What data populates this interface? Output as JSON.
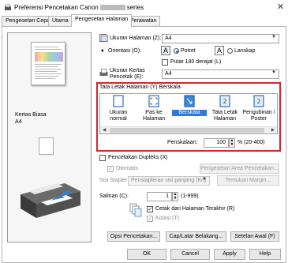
{
  "window": {
    "title_prefix": "Preferensi Pencetakan Canon",
    "title_suffix": "series",
    "close_glyph": "✕"
  },
  "tabs": [
    {
      "label": "Pengesetan Cepat"
    },
    {
      "label": "Utama"
    },
    {
      "label": "Pengesetan Halaman"
    },
    {
      "label": "Perawatan"
    }
  ],
  "preview": {
    "media_label": "Kertas Biasa",
    "size_label": "A4"
  },
  "page_size": {
    "label": "Ukuran Halaman (Z):",
    "value": "A4"
  },
  "orientation": {
    "label": "Orientasi (O):",
    "portrait": "Potret",
    "landscape": "Lanskap",
    "selected": "Potret",
    "rotate_label": "Putar 180 derajat (L)",
    "rotate_checked": false
  },
  "paper_size": {
    "label_line1": "Ukuran Kertas",
    "label_line2": "Pencetak (E):",
    "value": "A4"
  },
  "layout": {
    "group_label": "Tata Letak Halaman (Y) Berskala",
    "items": [
      {
        "label": "Ukuran normal"
      },
      {
        "label": "Pas ke Halaman"
      },
      {
        "label": "Berskala"
      },
      {
        "label": "Tata Letak Halaman"
      },
      {
        "label": "Pengubinan / Poster"
      }
    ],
    "selected": "Berskala",
    "tile_icon_numbers": [
      "2",
      "2"
    ],
    "scaling_label": "Penskalaan:",
    "scaling_value": "100",
    "scaling_range": "% (20-400)"
  },
  "duplex": {
    "label": "Pencetakan Dupleks (X)",
    "checked": false,
    "auto_label": "Otomatis",
    "area_button": "Pengesetan Area Pencetakan...",
    "stapling_label": "Sisi Stapler (L):",
    "stapling_value": "Penstapleran sisi panjang (Kri)",
    "margin_button": "Tentukan Margin..."
  },
  "copies": {
    "label": "Salinan (C):",
    "value": "1",
    "range": "(1-999)",
    "last_page_first_label": "Cetak dari Halaman Terakhir (R)",
    "last_page_first_checked": true,
    "collate_label": "Kolasi (T)",
    "collate_checked": true
  },
  "actions": {
    "print_options": "Opsi Pencetakan...",
    "stamp_background": "Cap/Latar Belakang...",
    "defaults": "Setelan Awal (F)",
    "ok": "OK",
    "cancel": "Cancel",
    "apply": "Apply",
    "help": "Help"
  },
  "colors": {
    "selection": "#3079d6",
    "highlight_frame": "#d9242b"
  }
}
